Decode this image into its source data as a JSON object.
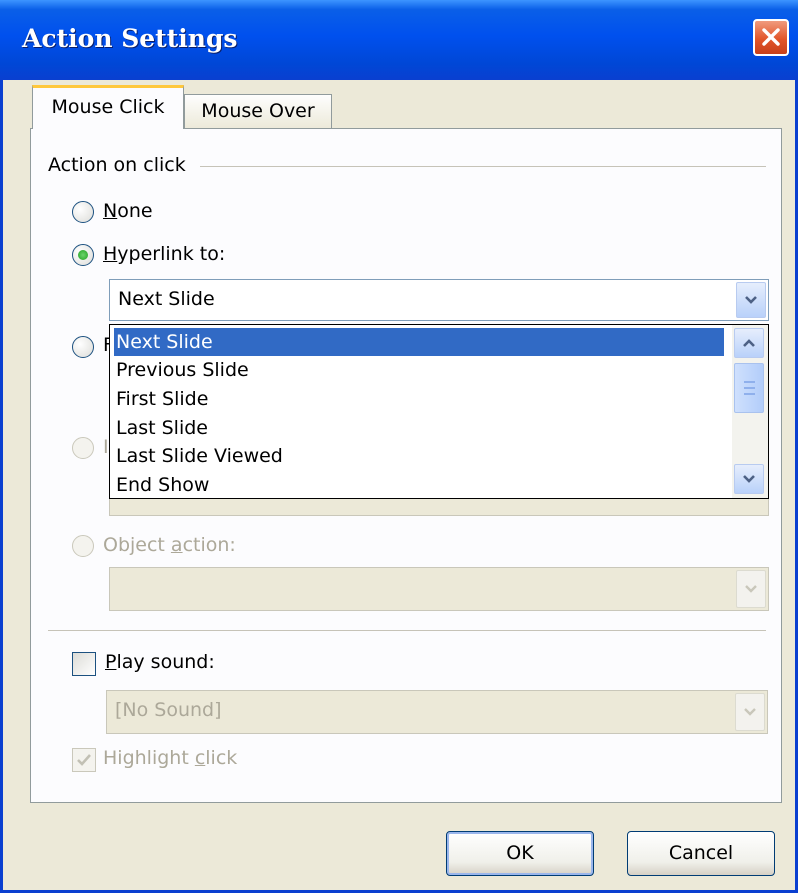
{
  "window": {
    "title": "Action Settings"
  },
  "tabs": [
    {
      "label": "Mouse Click",
      "active": true
    },
    {
      "label": "Mouse Over",
      "active": false
    }
  ],
  "group_label": "Action on click",
  "options": {
    "none": {
      "prefix": "",
      "accel": "N",
      "rest": "one"
    },
    "hyperlink": {
      "prefix": "",
      "accel": "H",
      "rest": "yperlink to:"
    },
    "run_program": {
      "visible": "F"
    },
    "run_macro": {
      "visible": "I"
    },
    "object_action": {
      "prefix": "Object ",
      "accel": "a",
      "rest": "ction:"
    }
  },
  "hyperlink_combo": {
    "value": "Next Slide"
  },
  "hyperlink_list": {
    "items": [
      "Next Slide",
      "Previous Slide",
      "First Slide",
      "Last Slide",
      "Last Slide Viewed",
      "End Show"
    ],
    "selected": "Next Slide"
  },
  "play_sound": {
    "accel": "P",
    "rest": "lay sound:",
    "checked": false
  },
  "sound_combo": {
    "value": "[No Sound]"
  },
  "highlight": {
    "prefix": "Highlight ",
    "accel": "c",
    "rest": "lick",
    "checked": true
  },
  "buttons": {
    "ok": "OK",
    "cancel": "Cancel"
  },
  "colors": {
    "title_bar": "#0050ee",
    "selection": "#316ac5",
    "dialog_bg": "#ece9d8",
    "close": "#e2552a"
  },
  "icons": [
    "close-icon",
    "chevron-down-icon",
    "chevron-up-icon",
    "check-icon"
  ]
}
